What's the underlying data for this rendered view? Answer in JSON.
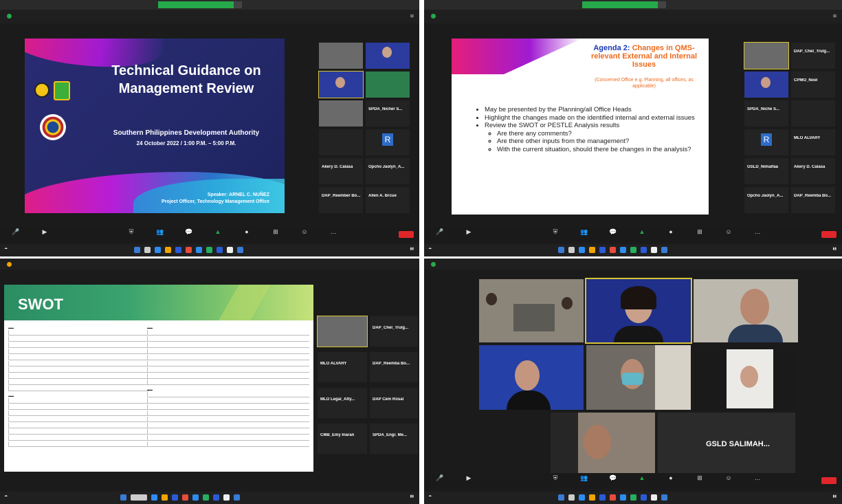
{
  "q1": {
    "slide": {
      "title": "Technical Guidance on Management Review",
      "org": "Southern Philippines Development Authority",
      "date": "24 October 2022 / 1:00 P.M. – 5:00 P.M.",
      "speaker": "Speaker: ARNEL C. NUÑEZ",
      "role": "Project Officer, Technology Management Office"
    },
    "participants": [
      {
        "name": "",
        "kind": "video"
      },
      {
        "name": "",
        "kind": "blue"
      },
      {
        "name": "",
        "kind": "video"
      },
      {
        "name": "",
        "kind": "green"
      },
      {
        "name": "",
        "kind": "video"
      },
      {
        "name": "SPDA_Nicher S...",
        "kind": "dark"
      },
      {
        "name": "",
        "kind": "dark"
      },
      {
        "name": "R",
        "kind": "r"
      },
      {
        "name": "Akery D. Calasa",
        "kind": "dark"
      },
      {
        "name": "Opcho Jaolyn_A...",
        "kind": "dark"
      },
      {
        "name": "DAP_Reember Bo...",
        "kind": "dark"
      },
      {
        "name": "Allen A. Brcue",
        "kind": "dark"
      }
    ]
  },
  "q2": {
    "slide": {
      "agenda_label": "Agenda 2:",
      "title_rest": "Changes in QMS-relevant External and Internal Issues",
      "subtitle": "(Concerned Office e.g. Planning, all offices, as applicable)",
      "bullets": [
        "May be presented by the Planning/all Office Heads",
        "Highlight the changes made on the identified internal and external issues",
        "Review the SWOT or PESTLE Analysis results"
      ],
      "sub_bullets": [
        "Are there any comments?",
        "Are there other inputs from the management?",
        "With the current situation, should there be changes in the analysis?"
      ]
    },
    "participants": [
      {
        "name": "",
        "kind": "video"
      },
      {
        "name": "DAP_Chel_Trulg...",
        "kind": "dark"
      },
      {
        "name": "",
        "kind": "video"
      },
      {
        "name": "CPMO_Noel",
        "kind": "dark"
      },
      {
        "name": "SPDA_Niche S...",
        "kind": "dark"
      },
      {
        "name": "",
        "kind": "dark"
      },
      {
        "name": "R",
        "kind": "r"
      },
      {
        "name": "MLO ALVARY",
        "kind": "dark"
      },
      {
        "name": "GSLD_Nimalfaa",
        "kind": "dark"
      },
      {
        "name": "Akery D. Calasa",
        "kind": "dark"
      },
      {
        "name": "Opcho Jaolyn_A...",
        "kind": "dark"
      },
      {
        "name": "DAP_Reemba Bo...",
        "kind": "dark"
      }
    ]
  },
  "q3": {
    "slide": {
      "title": "SWOT"
    },
    "participants": [
      {
        "name": "",
        "kind": "video"
      },
      {
        "name": "DAP_Chel_Trulg...",
        "kind": "dark"
      },
      {
        "name": "MLO ALVARY",
        "kind": "dark"
      },
      {
        "name": "DAP_Reemba Bo...",
        "kind": "dark"
      },
      {
        "name": "MLO Legal_Atty...",
        "kind": "dark"
      },
      {
        "name": "DAP Cem Rosal",
        "kind": "dark"
      },
      {
        "name": "CMB_Emy Inaran",
        "kind": "dark"
      },
      {
        "name": "SPDA_Engr. Me...",
        "kind": "dark"
      }
    ]
  },
  "q4": {
    "name_tile": "GSLD SALIMAH..."
  }
}
